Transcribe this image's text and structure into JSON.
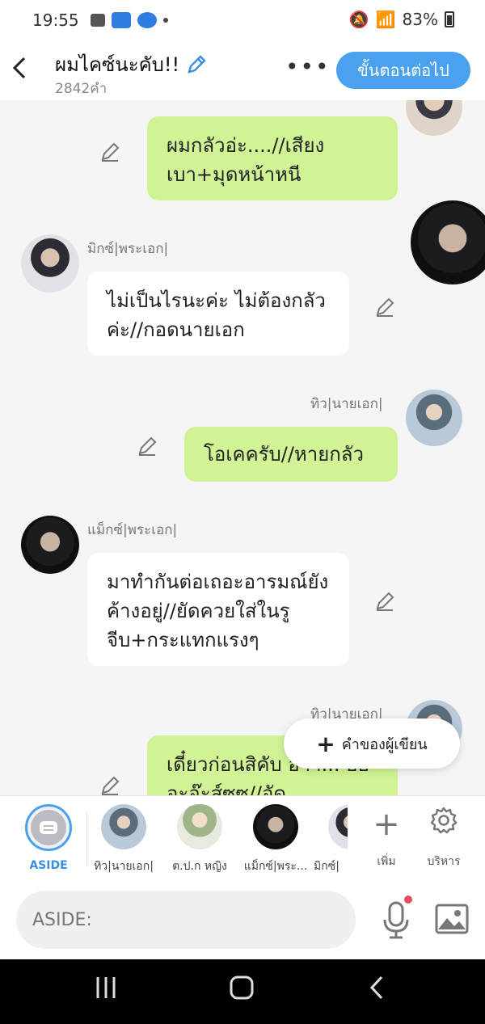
{
  "status_bar": {
    "time": "19:55",
    "battery": "83%"
  },
  "header": {
    "title": "ผมไคซ์นะคับ!!",
    "word_count": "2842คำ",
    "more_label": "•••",
    "next_button": "ขั้นตอนต่อไป"
  },
  "messages": [
    {
      "side": "right",
      "text": "ผมกลัวอ่ะ....//เสียงเบา+มุดหน้าหนี"
    },
    {
      "side": "left",
      "name": "มิกซ์|พระเอก|",
      "text": "ไม่เป็นไรนะค่ะ ไม่ต้องกลัวค่ะ//กอดนายเอก"
    },
    {
      "side": "right",
      "name": "ทิว|นายเอก|",
      "text": "โอเคครับ//หายกลัว"
    },
    {
      "side": "left",
      "name": "แม็กซ์|พระเอก|",
      "text": "มาทำกันต่อเถอะอารมณ์ยังค้างอยู่//ยัดควยใส่ในรูจีบ+กระแทกแรงๆ"
    },
    {
      "side": "right",
      "name": "ทิว|นายเอก|",
      "text": "เดี๋ยวก่อนสิคับ อ้าา... อื้ออะอ๊ะส์ซซ//อัด"
    }
  ],
  "author_fab": {
    "label": "คำของผู้เขียน"
  },
  "characters": {
    "aside_label": "ASIDE",
    "items": [
      {
        "name": "ทิว|นายเอก|"
      },
      {
        "name": "ต.ป.ก หญิง"
      },
      {
        "name": "แม็กซ์|พระ..."
      },
      {
        "name": "มิกซ์|"
      }
    ],
    "add_label": "เพิ่ม",
    "manage_label": "บริหาร"
  },
  "input": {
    "placeholder": "ASIDE:"
  },
  "colors": {
    "accent": "#4aa2ee",
    "bubble_right": "#d1f395",
    "bubble_left": "#ffffff"
  }
}
